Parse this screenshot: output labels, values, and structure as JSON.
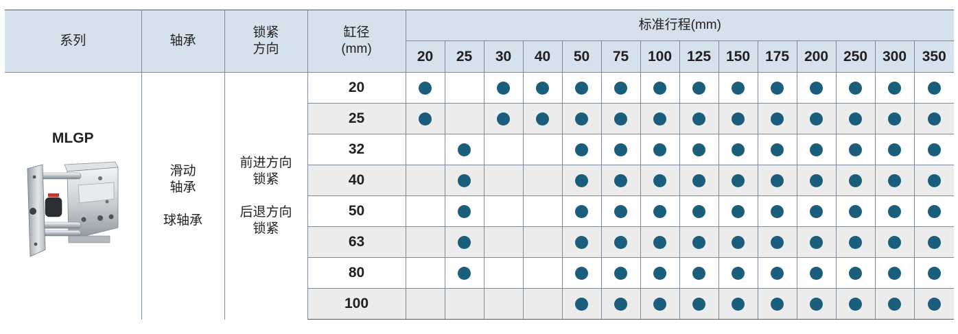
{
  "headers": {
    "series": "系列",
    "bearing": "轴承",
    "lock_direction_line1": "锁紧",
    "lock_direction_line2": "方向",
    "bore_line1": "缸径",
    "bore_line2": "(mm)",
    "standard_stroke": "标准行程(mm)"
  },
  "strokes": [
    "20",
    "25",
    "30",
    "40",
    "50",
    "75",
    "100",
    "125",
    "150",
    "175",
    "200",
    "250",
    "300",
    "350"
  ],
  "series_name": "MLGP",
  "bearing": {
    "line1": "滑动",
    "line2": "轴承",
    "line3": "球轴承"
  },
  "lock": {
    "line1": "前进方向",
    "line2": "锁紧",
    "line3": "后退方向",
    "line4": "锁紧"
  },
  "rows": [
    {
      "bore": "20",
      "available": [
        1,
        0,
        1,
        1,
        1,
        1,
        1,
        1,
        1,
        1,
        1,
        1,
        1,
        1
      ]
    },
    {
      "bore": "25",
      "available": [
        1,
        0,
        1,
        1,
        1,
        1,
        1,
        1,
        1,
        1,
        1,
        1,
        1,
        1
      ]
    },
    {
      "bore": "32",
      "available": [
        0,
        1,
        0,
        0,
        1,
        1,
        1,
        1,
        1,
        1,
        1,
        1,
        1,
        1
      ]
    },
    {
      "bore": "40",
      "available": [
        0,
        1,
        0,
        0,
        1,
        1,
        1,
        1,
        1,
        1,
        1,
        1,
        1,
        1
      ]
    },
    {
      "bore": "50",
      "available": [
        0,
        1,
        0,
        0,
        1,
        1,
        1,
        1,
        1,
        1,
        1,
        1,
        1,
        1
      ]
    },
    {
      "bore": "63",
      "available": [
        0,
        1,
        0,
        0,
        1,
        1,
        1,
        1,
        1,
        1,
        1,
        1,
        1,
        1
      ]
    },
    {
      "bore": "80",
      "available": [
        0,
        1,
        0,
        0,
        1,
        1,
        1,
        1,
        1,
        1,
        1,
        1,
        1,
        1
      ]
    },
    {
      "bore": "100",
      "available": [
        0,
        0,
        0,
        0,
        1,
        1,
        1,
        1,
        1,
        1,
        1,
        1,
        1,
        1
      ]
    }
  ],
  "colors": {
    "header_bg": "#d5e2ed",
    "stripe_bg": "#ececec",
    "dot": "#1a5e7c",
    "grid": "#7d8a95"
  }
}
